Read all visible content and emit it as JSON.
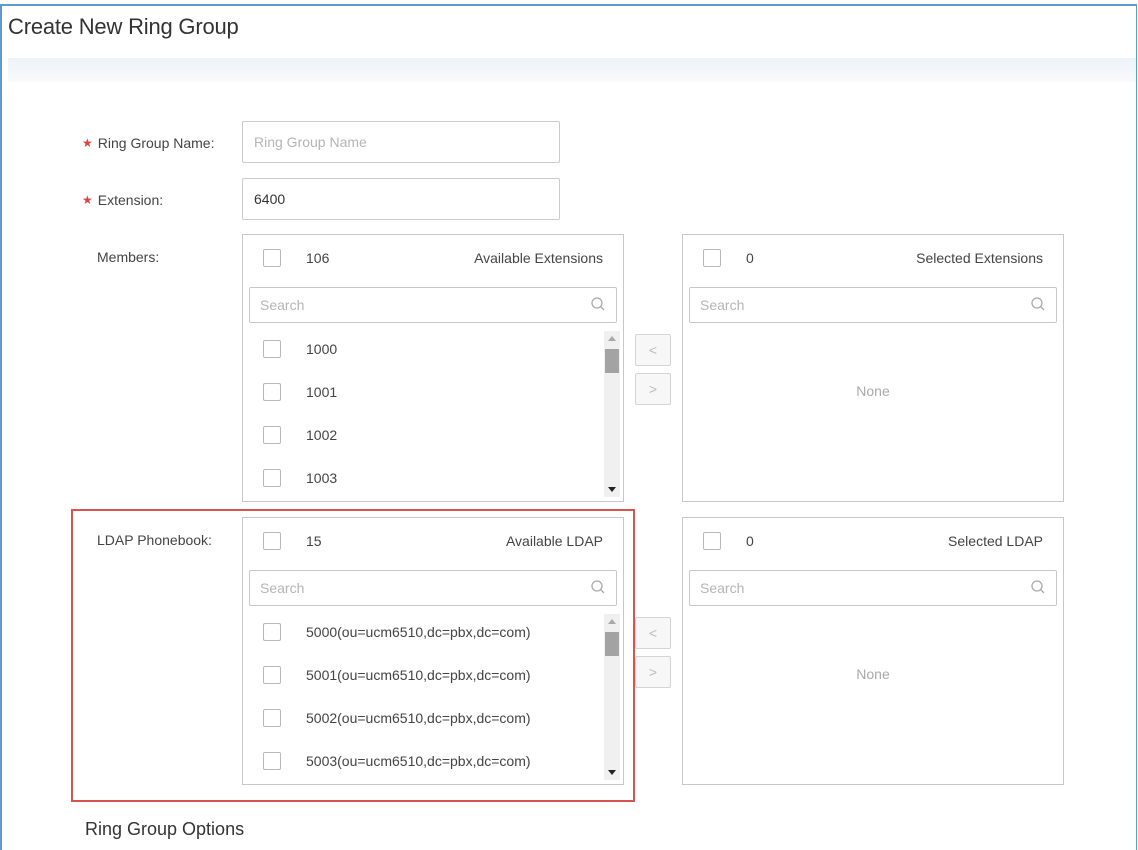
{
  "page": {
    "title": "Create New Ring Group"
  },
  "form": {
    "ring_group_name": {
      "label": "Ring Group Name:",
      "placeholder": "Ring Group Name",
      "value": ""
    },
    "extension": {
      "label": "Extension:",
      "value": "6400"
    },
    "members": {
      "label": "Members:",
      "available": {
        "count": "106",
        "title": "Available Extensions",
        "search_placeholder": "Search",
        "items": [
          "1000",
          "1001",
          "1002",
          "1003"
        ]
      },
      "selected": {
        "count": "0",
        "title": "Selected Extensions",
        "search_placeholder": "Search",
        "empty_text": "None"
      },
      "move_left_label": "<",
      "move_right_label": ">"
    },
    "ldap": {
      "label": "LDAP Phonebook:",
      "available": {
        "count": "15",
        "title": "Available LDAP",
        "search_placeholder": "Search",
        "items": [
          "5000(ou=ucm6510,dc=pbx,dc=com)",
          "5001(ou=ucm6510,dc=pbx,dc=com)",
          "5002(ou=ucm6510,dc=pbx,dc=com)",
          "5003(ou=ucm6510,dc=pbx,dc=com)"
        ]
      },
      "selected": {
        "count": "0",
        "title": "Selected LDAP",
        "search_placeholder": "Search",
        "empty_text": "None"
      },
      "move_left_label": "<",
      "move_right_label": ">"
    }
  },
  "sections": {
    "options_title": "Ring Group Options"
  },
  "colors": {
    "required": "#e34040",
    "highlight": "#d9534f",
    "frame": "#5b9bd5"
  },
  "icons": {
    "search": "search-icon"
  }
}
